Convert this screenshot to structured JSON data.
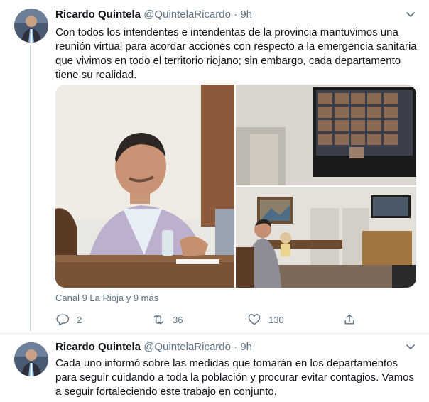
{
  "tweets": [
    {
      "author_name": "Ricardo Quintela",
      "handle": "@QuintelaRicardo",
      "separator": "·",
      "time": "9h",
      "text": "Con todos los intendentes e intendentas de la provincia mantuvimos una reunión virtual para acordar acciones con respecto a la emergencia sanitaria que vivimos en todo el territorio riojano; sin embargo, cada departamento tiene su realidad.",
      "media_tags": "Canal 9 La Rioja y 9 más",
      "actions": {
        "replies": "2",
        "retweets": "36",
        "likes": "130"
      }
    },
    {
      "author_name": "Ricardo Quintela",
      "handle": "@QuintelaRicardo",
      "separator": "·",
      "time": "9h",
      "text": "Cada uno informó sobre las medidas que tomarán en los departamentos para seguir cuidando a toda la población y procurar evitar contagios. Vamos a seguir fortaleciendo este trabajo en conjunto."
    }
  ],
  "icons": {
    "reply": "reply-icon",
    "retweet": "retweet-icon",
    "like": "like-icon",
    "share": "share-icon",
    "more": "chevron-down-icon"
  },
  "colors": {
    "text": "#0f1419",
    "secondary": "#5b7083",
    "thread_line": "#cfd9de",
    "divider": "#e6ecf0"
  }
}
